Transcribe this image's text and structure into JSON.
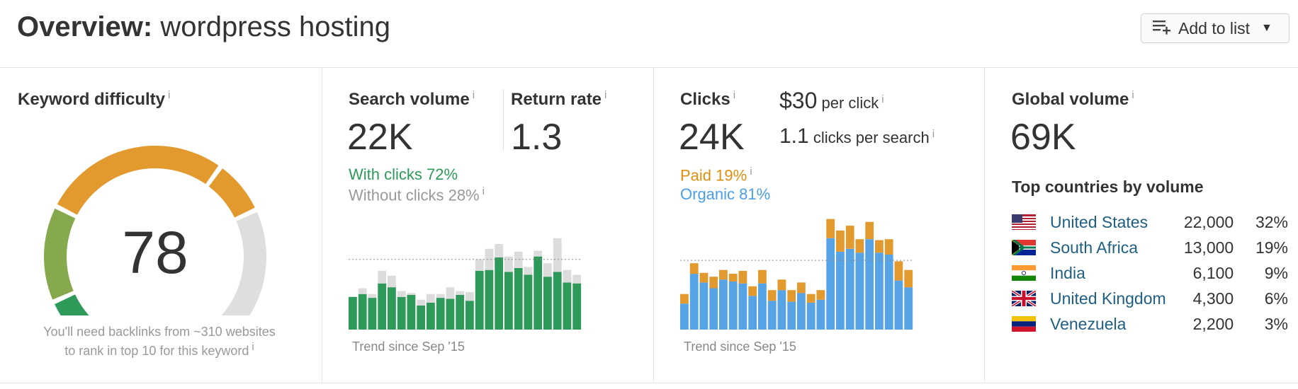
{
  "header": {
    "title_prefix": "Overview:",
    "keyword": "wordpress hosting",
    "add_to_list": "Add to list"
  },
  "keyword_difficulty": {
    "label": "Keyword difficulty",
    "info": "i",
    "value": "78",
    "score": 78,
    "note_line1": "You'll need backlinks from ~310 websites",
    "note_line2": "to rank in top 10 for this keyword",
    "colors": {
      "green_dark": "#2e9a5a",
      "green_olive": "#86a94e",
      "orange": "#e29a2e",
      "gray": "#dedede"
    }
  },
  "search_volume": {
    "label": "Search volume",
    "value": "22K",
    "return_rate_label": "Return rate",
    "return_rate": "1.3",
    "with_clicks": "With clicks 72%",
    "without_clicks": "Without clicks 28%",
    "trend_label": "Trend since Sep '15"
  },
  "clicks": {
    "label": "Clicks",
    "value": "24K",
    "cpc_value": "$30",
    "cpc_label": "per click",
    "cps_value": "1.1",
    "cps_label": "clicks per search",
    "paid": "Paid 19%",
    "organic": "Organic 81%",
    "trend_label": "Trend since Sep '15"
  },
  "global_volume": {
    "label": "Global volume",
    "value": "69K",
    "top_countries_label": "Top countries by volume",
    "countries": [
      {
        "name": "United States",
        "volume": "22,000",
        "pct": "32%",
        "flag": "us-flag"
      },
      {
        "name": "South Africa",
        "volume": "13,000",
        "pct": "19%",
        "flag": "za-flag"
      },
      {
        "name": "India",
        "volume": "6,100",
        "pct": "9%",
        "flag": "in-flag"
      },
      {
        "name": "United Kingdom",
        "volume": "4,300",
        "pct": "6%",
        "flag": "gb-flag"
      },
      {
        "name": "Venezuela",
        "volume": "2,200",
        "pct": "3%",
        "flag": "ve-flag"
      }
    ]
  },
  "chart_data": [
    {
      "type": "bar",
      "stacked": true,
      "series": [
        {
          "name": "With clicks",
          "color": "#2e9a5a",
          "values": [
            34,
            37,
            33,
            48,
            44,
            34,
            36,
            25,
            28,
            33,
            32,
            36,
            30,
            61,
            62,
            75,
            60,
            64,
            57,
            76,
            55,
            60,
            49,
            48
          ]
        },
        {
          "name": "Without clicks",
          "color": "#dcdcdc",
          "values": [
            0,
            6,
            4,
            13,
            12,
            6,
            2,
            6,
            9,
            4,
            12,
            4,
            9,
            12,
            22,
            14,
            16,
            17,
            8,
            6,
            14,
            35,
            13,
            9
          ]
        }
      ],
      "reference_line": 73
    },
    {
      "type": "bar",
      "stacked": true,
      "series": [
        {
          "name": "Organic",
          "color": "#56a3e6",
          "values": [
            27,
            58,
            49,
            43,
            52,
            50,
            48,
            35,
            48,
            30,
            41,
            29,
            38,
            28,
            31,
            95,
            81,
            84,
            80,
            94,
            80,
            78,
            51,
            44
          ]
        },
        {
          "name": "Paid",
          "color": "#e29a2e",
          "values": [
            10,
            11,
            10,
            12,
            10,
            8,
            13,
            10,
            14,
            11,
            11,
            12,
            11,
            9,
            10,
            20,
            22,
            24,
            14,
            18,
            13,
            16,
            20,
            18
          ]
        }
      ],
      "reference_line": 72
    }
  ]
}
